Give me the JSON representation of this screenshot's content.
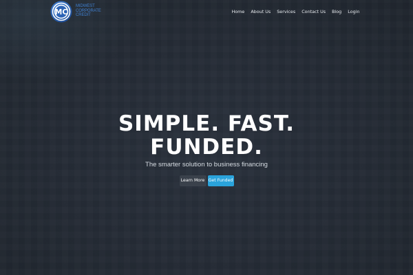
{
  "brand": {
    "logo_initials": "MC",
    "name_lines": [
      "MIDWEST",
      "CORPORATE",
      "CREDIT"
    ],
    "color_primary": "#3f7fd0",
    "color_dark": "#1f4f9a"
  },
  "nav": {
    "items": [
      {
        "label": "Home"
      },
      {
        "label": "About Us"
      },
      {
        "label": "Services"
      },
      {
        "label": "Contact Us"
      },
      {
        "label": "Blog"
      },
      {
        "label": "Login"
      }
    ]
  },
  "hero": {
    "headline_line1": "SIMPLE. FAST.",
    "headline_line2": "FUNDED.",
    "subhead": "The smarter solution to business financing",
    "buttons": {
      "learn_more": "Learn More",
      "get_funded": "Get Funded"
    },
    "colors": {
      "background": "#252c36",
      "primary_button": "#2aa3db",
      "secondary_button": "#3a414b"
    }
  }
}
